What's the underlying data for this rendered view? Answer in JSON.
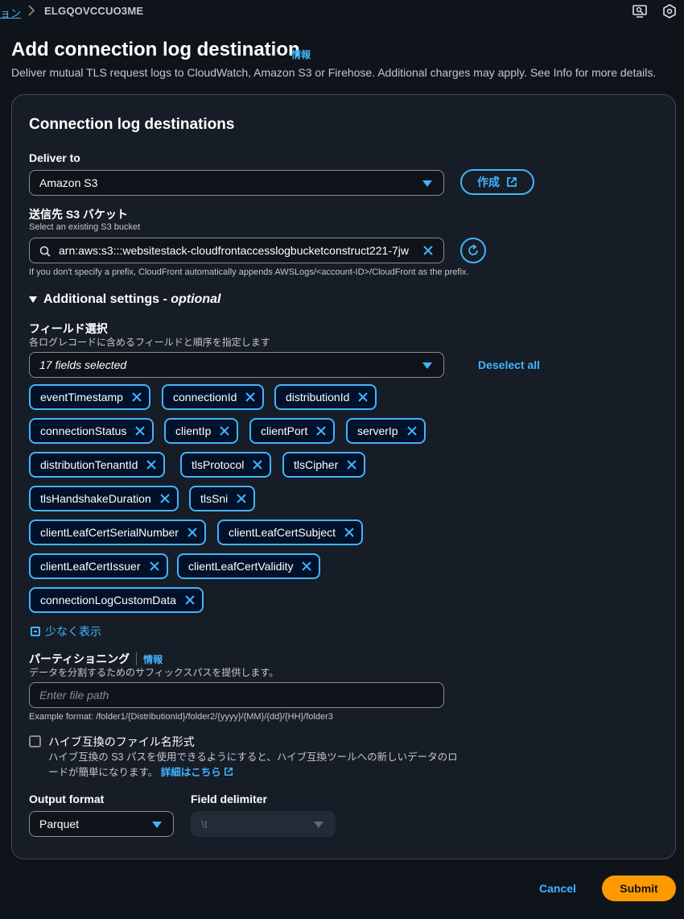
{
  "breadcrumb": {
    "previous": "ョン",
    "current": "ELGQOVCCUO3ME"
  },
  "header": {
    "title": "Add connection log destination",
    "info": "情報",
    "description": "Deliver mutual TLS request logs to CloudWatch, Amazon S3 or Firehose. Additional charges may apply. See Info for more details."
  },
  "panel": {
    "title": "Connection log destinations",
    "deliver_to": {
      "label": "Deliver to",
      "value": "Amazon S3",
      "create_button": "作成"
    },
    "bucket": {
      "label": "送信先 S3 バケット",
      "description": "Select an existing S3 bucket",
      "value": "arn:aws:s3:::websitestack-cloudfrontaccesslogbucketconstruct221-7jw",
      "hint": "If you don't specify a prefix, CloudFront automatically appends AWSLogs/<account-ID>/CloudFront as the prefix."
    },
    "additional": {
      "header_main": "Additional settings",
      "header_suffix": " - optional",
      "fields": {
        "label": "フィールド選択",
        "description": "各ログレコードに含めるフィールドと順序を指定します",
        "selected_text": "17 fields selected",
        "deselect_all": "Deselect all",
        "tokens": [
          "eventTimestamp",
          "connectionId",
          "distributionId",
          "connectionStatus",
          "clientIp",
          "clientPort",
          "serverIp",
          "distributionTenantId",
          "tlsProtocol",
          "tlsCipher",
          "tlsHandshakeDuration",
          "tlsSni",
          "clientLeafCertSerialNumber",
          "clientLeafCertSubject",
          "clientLeafCertIssuer",
          "clientLeafCertValidity",
          "connectionLogCustomData"
        ],
        "show_less": "少なく表示"
      },
      "partitioning": {
        "label": "パーティショニング",
        "info": "情報",
        "description": "データを分割するためのサフィックスパスを提供します。",
        "placeholder": "Enter file path",
        "example": "Example format: /folder1/{DistributionId}/folder2/{yyyy}/{MM}/{dd}/{HH}/folder3"
      },
      "hive": {
        "label": "ハイブ互換のファイル名形式",
        "description": "ハイブ互換の S3 パスを使用できるようにすると、ハイブ互換ツールへの新しいデータのロードが簡単になります。",
        "link": "詳細はこちら",
        "checked": false
      },
      "output_format": {
        "label": "Output format",
        "value": "Parquet"
      },
      "field_delimiter": {
        "label": "Field delimiter",
        "value": "\\t"
      }
    }
  },
  "footer": {
    "cancel": "Cancel",
    "submit": "Submit"
  },
  "colors": {
    "accent": "#42b4ff",
    "primary_button": "#ff9900",
    "background": "#0f141a"
  }
}
